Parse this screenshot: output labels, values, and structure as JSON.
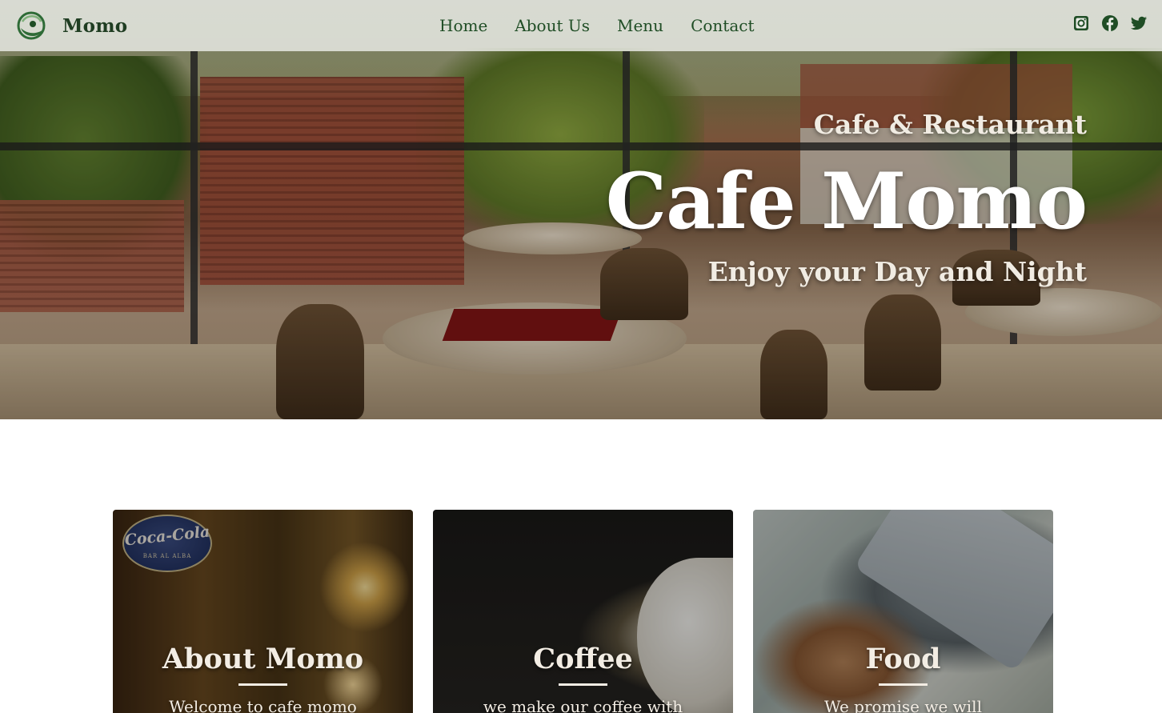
{
  "navbar": {
    "brand_name": "Momo",
    "links": [
      {
        "label": "Home"
      },
      {
        "label": "About Us"
      },
      {
        "label": "Menu"
      },
      {
        "label": "Contact"
      }
    ],
    "social_icons": [
      "instagram-icon",
      "facebook-icon",
      "twitter-icon"
    ]
  },
  "hero": {
    "subtitle_top": "Cafe & Restaurant",
    "title": "Cafe Momo",
    "subtitle_bottom": "Enjoy your Day and Night"
  },
  "cards": [
    {
      "title": "About Momo",
      "text": "Welcome to cafe momo",
      "sign_text": "Coca-Cola",
      "sign_sub": "BAR AL ALBA"
    },
    {
      "title": "Coffee",
      "text": "we make our coffee with"
    },
    {
      "title": "Food",
      "text": "We promise we will"
    }
  ],
  "colors": {
    "brand_green": "#1f4d25",
    "navbar_bg": "#ebede8",
    "hero_text": "#ffffff"
  }
}
